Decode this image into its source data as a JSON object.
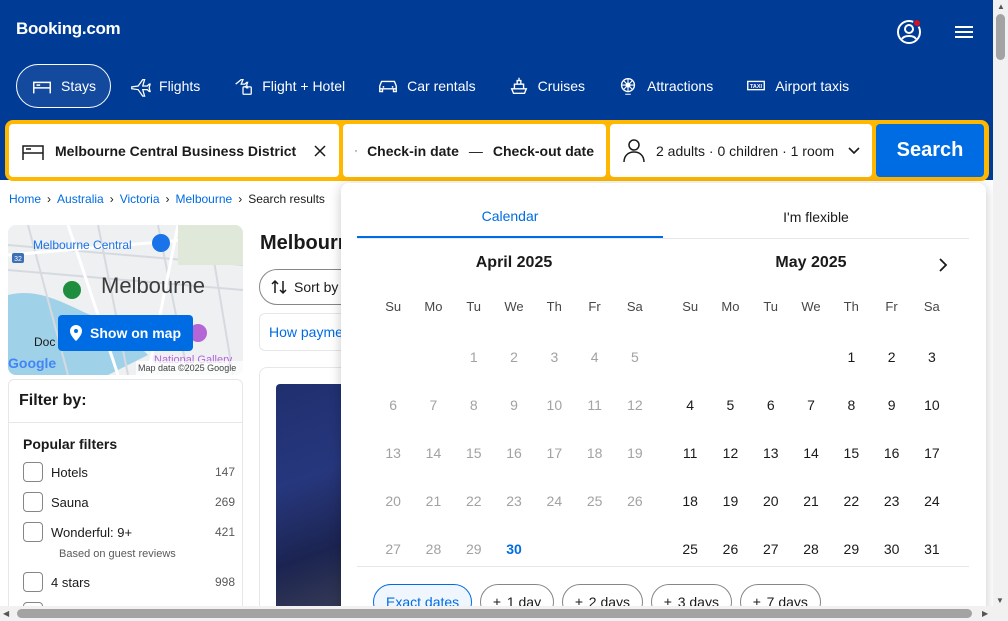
{
  "header": {
    "logo": "Booking.com",
    "nav": [
      {
        "label": "Stays",
        "icon": "bed-icon",
        "active": true
      },
      {
        "label": "Flights",
        "icon": "plane-icon"
      },
      {
        "label": "Flight + Hotel",
        "icon": "flight-hotel-icon"
      },
      {
        "label": "Car rentals",
        "icon": "car-icon"
      },
      {
        "label": "Cruises",
        "icon": "ship-icon"
      },
      {
        "label": "Attractions",
        "icon": "attractions-icon"
      },
      {
        "label": "Airport taxis",
        "icon": "taxi-icon"
      }
    ]
  },
  "search": {
    "destination": "Melbourne Central Business District",
    "checkin": "Check-in date",
    "dash": "—",
    "checkout": "Check-out date",
    "guests": "2 adults · 0 children · 1 room",
    "button": "Search"
  },
  "breadcrumbs": [
    "Home",
    "Australia",
    "Victoria",
    "Melbourne",
    "Search results"
  ],
  "map": {
    "button": "Show on map",
    "labels": {
      "central": "Melbourne Central",
      "city": "Melbourne",
      "docklands": "Doc",
      "gallery": "National Gallery",
      "credit": "Map data ©2025 Google",
      "google": "Google",
      "shield": "32"
    }
  },
  "filter": {
    "title": "Filter by:",
    "subtitle": "Popular filters",
    "items": [
      {
        "label": "Hotels",
        "count": "147"
      },
      {
        "label": "Sauna",
        "count": "269"
      },
      {
        "label": "Wonderful: 9+",
        "count": "421",
        "note": "Based on guest reviews"
      },
      {
        "label": "4 stars",
        "count": "998"
      }
    ]
  },
  "results": {
    "title": "Melbourne",
    "sort": "Sort by",
    "how_pay": "How payment works"
  },
  "calendar": {
    "tabs": [
      "Calendar",
      "I'm flexible"
    ],
    "weekdays": [
      "Su",
      "Mo",
      "Tu",
      "We",
      "Th",
      "Fr",
      "Sa"
    ],
    "april": {
      "title": "April 2025",
      "days": [
        "",
        "",
        "1",
        "2",
        "3",
        "4",
        "5",
        "6",
        "7",
        "8",
        "9",
        "10",
        "11",
        "12",
        "13",
        "14",
        "15",
        "16",
        "17",
        "18",
        "19",
        "20",
        "21",
        "22",
        "23",
        "24",
        "25",
        "26",
        "27",
        "28",
        "29",
        "30"
      ],
      "today": "30"
    },
    "may": {
      "title": "May 2025",
      "days": [
        "",
        "",
        "",
        "",
        "1",
        "2",
        "3",
        "4",
        "5",
        "6",
        "7",
        "8",
        "9",
        "10",
        "11",
        "12",
        "13",
        "14",
        "15",
        "16",
        "17",
        "18",
        "19",
        "20",
        "21",
        "22",
        "23",
        "24",
        "25",
        "26",
        "27",
        "28",
        "29",
        "30",
        "31"
      ]
    },
    "chips": [
      {
        "label": "Exact dates",
        "active": true
      },
      {
        "label": "1 day",
        "plus": "±"
      },
      {
        "label": "2 days",
        "plus": "±"
      },
      {
        "label": "3 days",
        "plus": "±"
      },
      {
        "label": "7 days",
        "plus": "±"
      }
    ]
  },
  "colors": {
    "brand": "#003b95",
    "accent": "#006ce4",
    "search_border": "#ffb700"
  }
}
